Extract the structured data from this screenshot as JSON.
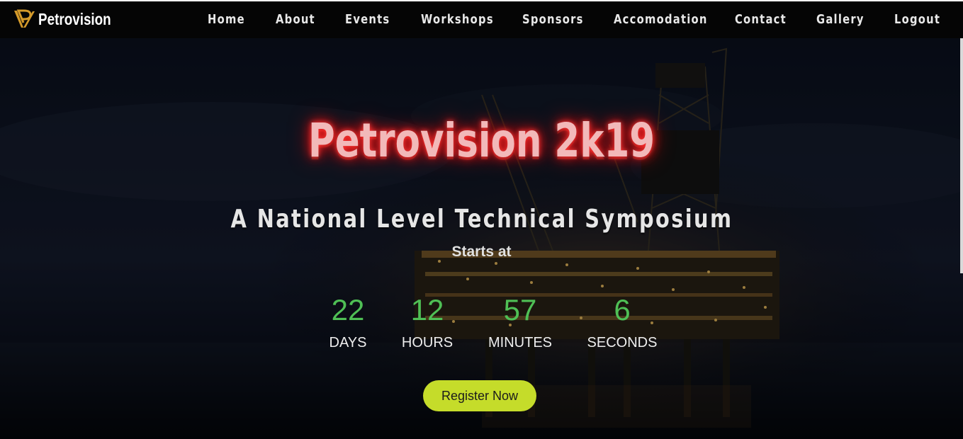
{
  "brand": {
    "name": "Petrovision",
    "logo_icon": "petrovision-logo-icon",
    "logo_color": "#d49a2a"
  },
  "nav": {
    "items": [
      {
        "label": "Home"
      },
      {
        "label": "About"
      },
      {
        "label": "Events"
      },
      {
        "label": "Workshops"
      },
      {
        "label": "Sponsors"
      },
      {
        "label": "Accomodation"
      },
      {
        "label": "Contact"
      },
      {
        "label": "Gallery"
      },
      {
        "label": "Logout"
      }
    ]
  },
  "hero": {
    "title": "Petrovision 2k19",
    "subtitle": "A National Level Technical Symposium",
    "starts_at": "Starts at",
    "background": "offshore-oil-rig-at-night"
  },
  "countdown": {
    "days": {
      "value": "22",
      "label": "DAYS"
    },
    "hours": {
      "value": "12",
      "label": "HOURS"
    },
    "minutes": {
      "value": "57",
      "label": "MINUTES"
    },
    "seconds": {
      "value": "6",
      "label": "SECONDS"
    }
  },
  "cta": {
    "register_label": "Register Now"
  },
  "colors": {
    "title_glow": "#ff2a2a",
    "countdown_value": "#4fbf55",
    "register_button": "#c5dc2a",
    "navbar": "#050505"
  }
}
